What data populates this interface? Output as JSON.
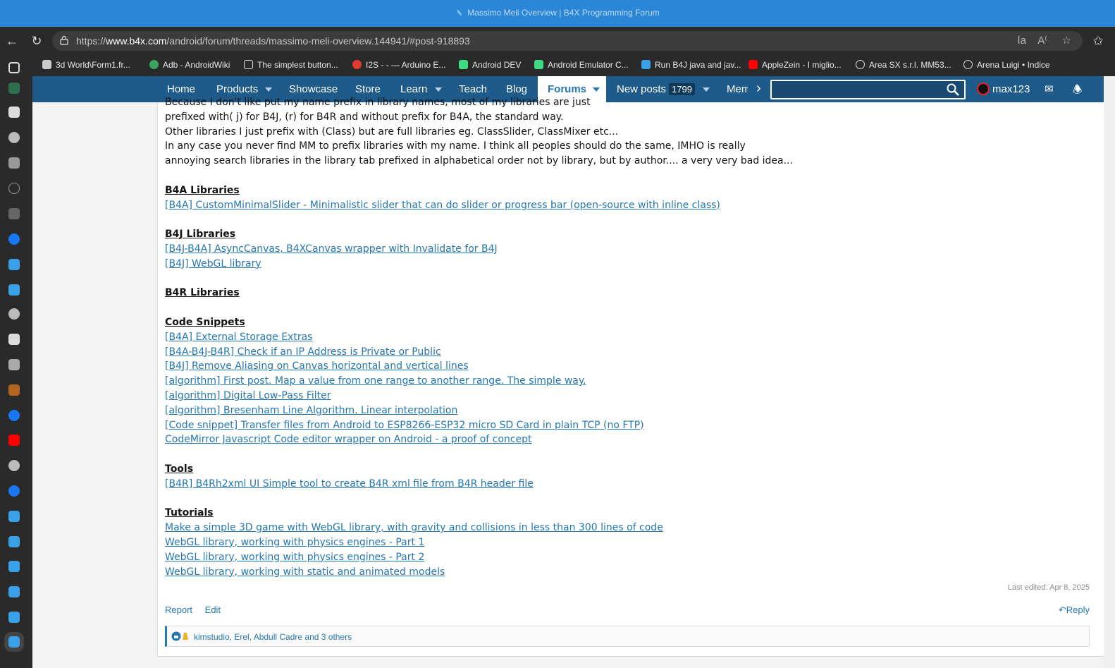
{
  "window": {
    "title": "Massimo Meli Overview | B4X Programming Forum"
  },
  "addressbar": {
    "url_prefix": "https://",
    "url_domain": "www.b4x.com",
    "url_path": "/android/forum/threads/massimo-meli-overview.144941/#post-918893"
  },
  "bookmarks": [
    {
      "label": "3d World\\Form1.fr...",
      "icon": "figure-icon",
      "color": "#cccccc"
    },
    {
      "label": "Adb - AndroidWiki",
      "icon": "android-wiki-icon",
      "color": "#3ba55d"
    },
    {
      "label": "The simplest button...",
      "icon": "page-icon",
      "color": "#dddddd"
    },
    {
      "label": "I2S - - — Arduino E...",
      "icon": "arduino-icon",
      "color": "#e03c31"
    },
    {
      "label": "Android DEV",
      "icon": "android-icon",
      "color": "#3ddc84"
    },
    {
      "label": "Android Emulator C...",
      "icon": "android-icon",
      "color": "#3ddc84"
    },
    {
      "label": "Run B4J java and jav...",
      "icon": "b4x-icon",
      "color": "#3aa0e8"
    },
    {
      "label": "AppleZein - I miglio...",
      "icon": "youtube-icon",
      "color": "#ff0000"
    },
    {
      "label": "Area SX s.r.l. MM53...",
      "icon": "globe-icon",
      "color": "#dddddd"
    },
    {
      "label": "Arena Luigi • Indice",
      "icon": "globe-icon",
      "color": "#dddddd"
    }
  ],
  "nav": {
    "home": "Home",
    "products": "Products",
    "showcase": "Showcase",
    "store": "Store",
    "learn": "Learn",
    "teach": "Teach",
    "blog": "Blog",
    "forums": "Forums",
    "new_posts": "New posts",
    "new_posts_count": "1799",
    "members": "Mem",
    "username": "max123"
  },
  "post": {
    "intro_lines": [
      "Because I don't like put my name prefix in library names, most of my libraries are just",
      "prefixed with( j) for B4J, (r) for B4R and without prefix for B4A, the standard way.",
      "Other libraries I just prefix with (Class) but are full libraries eg. ClassSlider, ClassMixer etc...",
      "In any case you never find MM to prefix libraries with my name. I think all peoples should do the same, IMHO is really",
      "annoying search libraries in the library tab prefixed in alphabetical order not by library, but by author.... a very very bad idea..."
    ],
    "sections": [
      {
        "heading": "B4A Libraries",
        "links": [
          "[B4A] CustomMinimalSlider - Minimalistic slider that can do slider or progress bar (open-source with inline class)"
        ]
      },
      {
        "heading": "B4J Libraries",
        "links": [
          "[B4J-B4A] AsyncCanvas, B4XCanvas wrapper with Invalidate for B4J",
          "[B4J] WebGL library"
        ]
      },
      {
        "heading": "B4R Libraries",
        "links": []
      },
      {
        "heading": "Code Snippets",
        "links": [
          "[B4A] External Storage Extras",
          "[B4A-B4J-B4R] Check if an IP Address is Private or Public",
          "[B4J] Remove Aliasing on Canvas horizontal and vertical lines",
          "[algorithm] First post. Map a value from one range to another range. The simple way.",
          "[algorithm] Digital Low-Pass Filter",
          "[algorithm] Bresenham Line Algorithm. Linear interpolation",
          "[Code snippet] Transfer files from Android to ESP8266-ESP32 micro SD Card in plain TCP (no FTP)",
          "CodeMirror Javascript Code editor wrapper on Android - a proof of concept"
        ]
      },
      {
        "heading": "Tools",
        "links": [
          "[B4R] B4Rh2xml UI Simple tool to create B4R xml file from B4R header file"
        ]
      },
      {
        "heading": "Tutorials",
        "links": [
          "Make a simple 3D game with WebGL library, with gravity and collisions in less than 300 lines of code",
          "WebGL library, working with physics engines - Part 1",
          "WebGL library, working with physics engines - Part 2",
          "WebGL library, working with static and animated models"
        ]
      }
    ],
    "last_edited": "Last edited: Apr 8, 2025",
    "report": "Report",
    "edit": "Edit",
    "reply": "Reply",
    "reactions_text": "kimstudio, Erel, Abdull Cadre and 3 others"
  },
  "colors": {
    "link": "#2577b1",
    "nav_bg": "#1e5a8a",
    "titlebar": "#2b86d8"
  }
}
